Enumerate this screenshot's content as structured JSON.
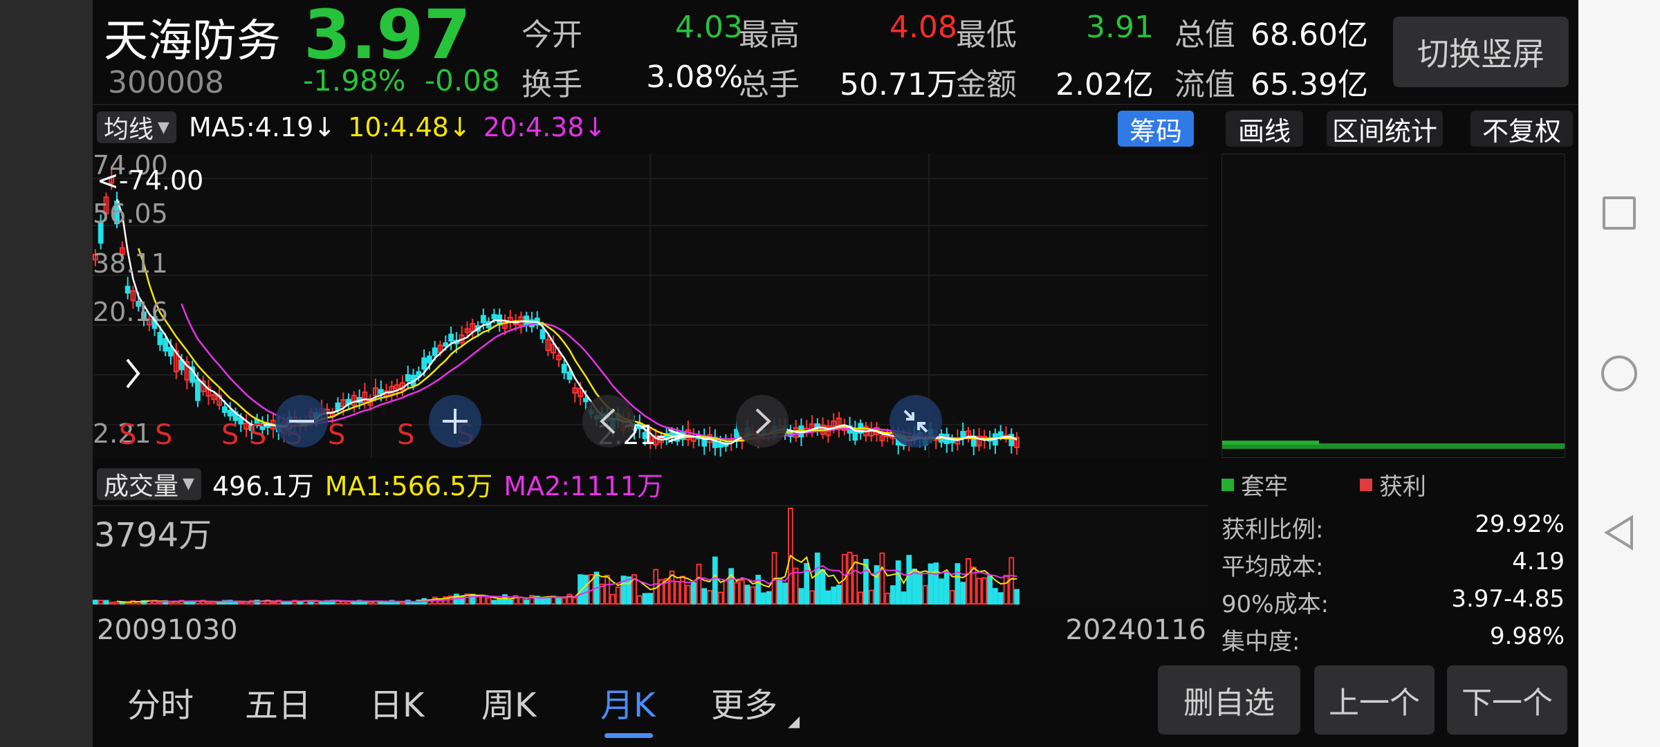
{
  "header": {
    "name": "天海防务",
    "code": "300008",
    "price": "3.97",
    "change_pct": "-1.98%",
    "change_abs": "-0.08",
    "switch_button": "切换竖屏",
    "stats": [
      {
        "label": "今开",
        "value": "4.03",
        "color": "#27c33a"
      },
      {
        "label": "最高",
        "value": "4.08",
        "color": "#ff2b2b"
      },
      {
        "label": "最低",
        "value": "3.91",
        "color": "#27c33a"
      },
      {
        "label": "总值",
        "value": "68.60亿",
        "color": "#ffffff"
      },
      {
        "label": "换手",
        "value": "3.08%",
        "color": "#ffffff"
      },
      {
        "label": "总手",
        "value": "50.71万",
        "color": "#ffffff"
      },
      {
        "label": "金额",
        "value": "2.02亿",
        "color": "#ffffff"
      },
      {
        "label": "流值",
        "value": "65.39亿",
        "color": "#ffffff"
      }
    ]
  },
  "ma_bar": {
    "selector": "均线",
    "ma5": "MA5:4.19",
    "ma10": "10:4.48",
    "ma20": "20:4.38",
    "arrow": "↓"
  },
  "tools": {
    "chips": "筹码",
    "draw": "画线",
    "range": "区间统计",
    "adjust": "不复权"
  },
  "kchart": {
    "price_labels": [
      "74.00",
      "56.05",
      "38.11",
      "20.16",
      "2.21"
    ],
    "max_marker": "<-74.00",
    "min_marker": "2.21->",
    "signal_char": "S",
    "colors": {
      "up": "#ff3232",
      "down": "#22e1e8",
      "ma5": "#ffffff",
      "ma10": "#f5e600",
      "ma20": "#e632e6"
    }
  },
  "volume": {
    "selector": "成交量",
    "current": "496.1万",
    "ma1": "MA1:566.5万",
    "ma2": "MA2:1111万",
    "max_label": "3794万",
    "date_start": "20091030",
    "date_end": "20240116"
  },
  "chips_panel": {
    "legend_trap": "套牢",
    "legend_profit": "获利",
    "stats": [
      {
        "label": "获利比例:",
        "value": "29.92%"
      },
      {
        "label": "平均成本:",
        "value": "4.19"
      },
      {
        "label": "90%成本:",
        "value": "3.97-4.85"
      },
      {
        "label": "集中度:",
        "value": "9.98%"
      }
    ]
  },
  "bottom_tabs": [
    "分时",
    "五日",
    "日K",
    "周K",
    "月K",
    "更多"
  ],
  "bottom_actions": {
    "remove": "删自选",
    "prev": "上一个",
    "next": "下一个"
  }
}
